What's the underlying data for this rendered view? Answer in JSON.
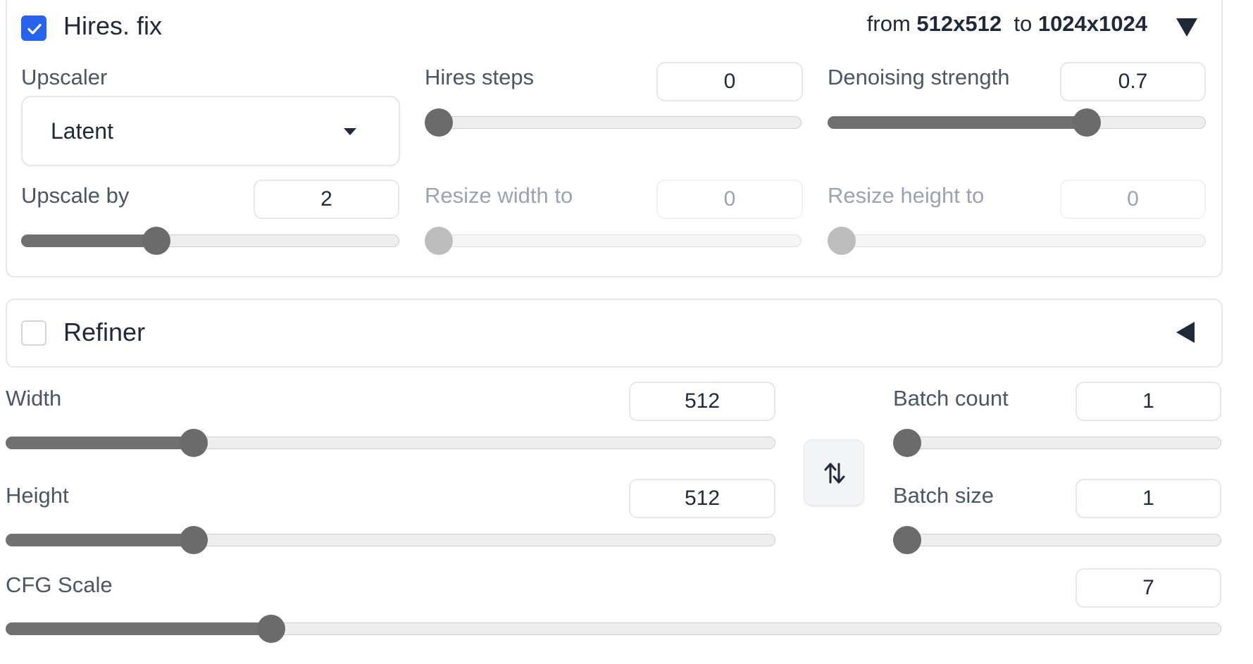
{
  "hires": {
    "title": "Hires. fix",
    "enabled": true,
    "summary": {
      "from_text": "from",
      "from_value": "512x512",
      "to_text": "to",
      "to_value": "1024x1024"
    },
    "upscaler": {
      "label": "Upscaler",
      "value": "Latent"
    },
    "hires_steps": {
      "label": "Hires steps",
      "value": "0",
      "fraction": 0.0
    },
    "denoising": {
      "label": "Denoising strength",
      "value": "0.7",
      "fraction": 0.7
    },
    "upscale_by": {
      "label": "Upscale by",
      "value": "2",
      "fraction": 0.347
    },
    "resize_width": {
      "label": "Resize width to",
      "value": "0",
      "fraction": 0.0
    },
    "resize_height": {
      "label": "Resize height to",
      "value": "0",
      "fraction": 0.0
    }
  },
  "refiner": {
    "title": "Refiner",
    "enabled": false
  },
  "size": {
    "width": {
      "label": "Width",
      "value": "512",
      "fraction": 0.235
    },
    "height": {
      "label": "Height",
      "value": "512",
      "fraction": 0.235
    }
  },
  "batch": {
    "count": {
      "label": "Batch count",
      "value": "1",
      "fraction": 0.0
    },
    "size": {
      "label": "Batch size",
      "value": "1",
      "fraction": 0.0
    }
  },
  "cfg": {
    "label": "CFG Scale",
    "value": "7",
    "fraction": 0.212
  },
  "icons": {
    "swap": "swap-vertical-icon",
    "checkmark": "checkmark-icon",
    "caret": "caret-down-icon",
    "collapse_open": "triangle-down-icon",
    "collapse_closed": "triangle-left-icon"
  },
  "colors": {
    "accent": "#2563eb",
    "slider_thumb": "#6b6b6b",
    "slider_fill": "#707070"
  }
}
